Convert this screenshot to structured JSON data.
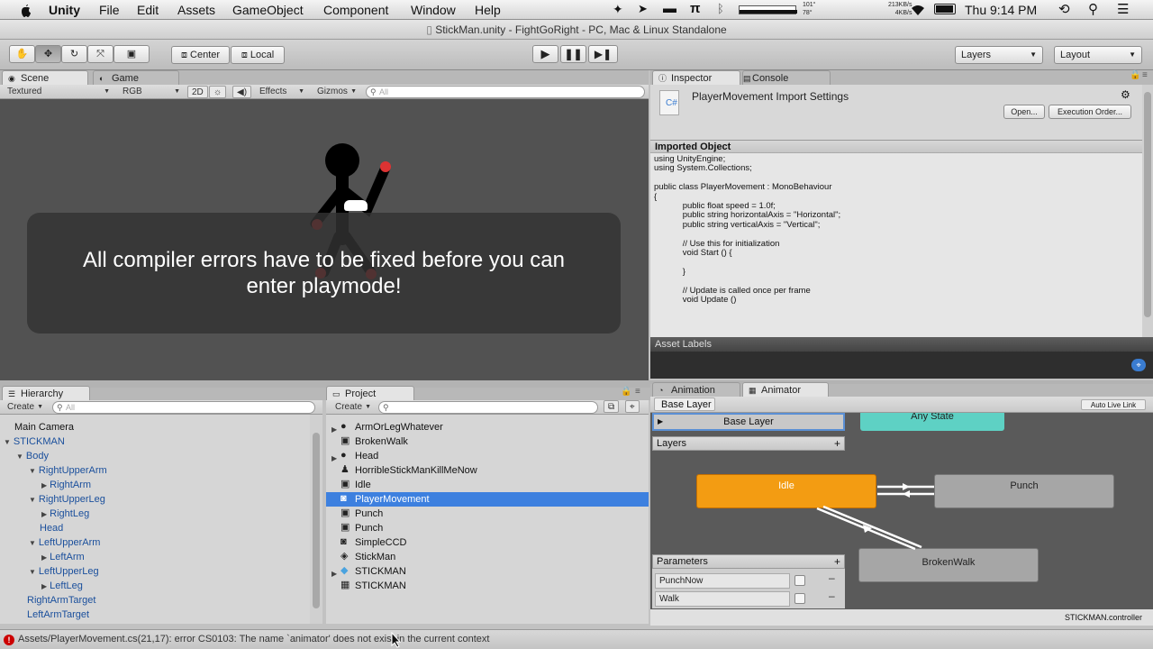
{
  "menubar": {
    "app": "Unity",
    "items": [
      "File",
      "Edit",
      "Assets",
      "GameObject",
      "Component",
      "Window",
      "Help"
    ],
    "temp_top": "101°",
    "temp_bottom": "78°",
    "net_top": "213KB/s",
    "net_bottom": "4KB/s",
    "clock": "Thu 9:14 PM"
  },
  "window": {
    "title": "StickMan.unity - FightGoRight - PC, Mac & Linux Standalone"
  },
  "toolbar": {
    "center_label": "Center",
    "local_label": "Local",
    "layers_label": "Layers",
    "layout_label": "Layout"
  },
  "scene": {
    "tab_scene": "Scene",
    "tab_game": "Game",
    "render_mode": "Textured",
    "color_mode": "RGB",
    "btn_2d": "2D",
    "effects": "Effects",
    "gizmos": "Gizmos",
    "search_placeholder": "All",
    "message": "All compiler errors have to be fixed before you can enter playmode!"
  },
  "inspector": {
    "tab_inspector": "Inspector",
    "tab_console": "Console",
    "title": "PlayerMovement Import Settings",
    "open_btn": "Open...",
    "exec_btn": "Execution Order...",
    "section": "Imported Object",
    "code": "using UnityEngine;\nusing System.Collections;\n\npublic class PlayerMovement : MonoBehaviour\n{\n\t\tpublic float speed = 1.0f;\n\t\tpublic string horizontalAxis = \"Horizontal\";\n\t\tpublic string verticalAxis = \"Vertical\";\n\n\t\t// Use this for initialization\n\t\tvoid Start () {\n\n\t\t}\n\n\t\t// Update is called once per frame\n\t\tvoid Update ()",
    "asset_labels": "Asset Labels"
  },
  "hierarchy": {
    "tab": "Hierarchy",
    "create": "Create",
    "search_placeholder": "All",
    "items": [
      {
        "label": "Main Camera",
        "indent": 0,
        "arrow": "",
        "black": true
      },
      {
        "label": "STICKMAN",
        "indent": 0,
        "arrow": "▼",
        "black": false
      },
      {
        "label": "Body",
        "indent": 1,
        "arrow": "▼",
        "black": false
      },
      {
        "label": "RightUpperArm",
        "indent": 2,
        "arrow": "▼",
        "black": false
      },
      {
        "label": "RightArm",
        "indent": 3,
        "arrow": "▶",
        "black": false
      },
      {
        "label": "RightUpperLeg",
        "indent": 2,
        "arrow": "▼",
        "black": false
      },
      {
        "label": "RightLeg",
        "indent": 3,
        "arrow": "▶",
        "black": false
      },
      {
        "label": "Head",
        "indent": 2,
        "arrow": "",
        "black": false
      },
      {
        "label": "LeftUpperArm",
        "indent": 2,
        "arrow": "▼",
        "black": false
      },
      {
        "label": "LeftArm",
        "indent": 3,
        "arrow": "▶",
        "black": false
      },
      {
        "label": "LeftUpperLeg",
        "indent": 2,
        "arrow": "▼",
        "black": false
      },
      {
        "label": "LeftLeg",
        "indent": 3,
        "arrow": "▶",
        "black": false
      },
      {
        "label": "RightArmTarget",
        "indent": 1,
        "arrow": "",
        "black": false
      },
      {
        "label": "LeftArmTarget",
        "indent": 1,
        "arrow": "",
        "black": false
      }
    ]
  },
  "project": {
    "tab": "Project",
    "create": "Create",
    "items": [
      {
        "label": "ArmOrLegWhatever",
        "icon": "sprite-icon",
        "arrow": "▶"
      },
      {
        "label": "BrokenWalk",
        "icon": "animation-icon",
        "arrow": ""
      },
      {
        "label": "Head",
        "icon": "sprite-icon",
        "arrow": "▶"
      },
      {
        "label": "HorribleStickManKillMeNow",
        "icon": "avatar-icon",
        "arrow": ""
      },
      {
        "label": "Idle",
        "icon": "animation-icon",
        "arrow": ""
      },
      {
        "label": "PlayerMovement",
        "icon": "script-icon",
        "arrow": ""
      },
      {
        "label": "Punch",
        "icon": "animation-icon",
        "arrow": ""
      },
      {
        "label": "Punch",
        "icon": "animation-icon",
        "arrow": ""
      },
      {
        "label": "SimpleCCD",
        "icon": "script-icon",
        "arrow": ""
      },
      {
        "label": "StickMan",
        "icon": "unity-scene-icon",
        "arrow": ""
      },
      {
        "label": "STICKMAN",
        "icon": "prefab-icon",
        "arrow": "▶"
      },
      {
        "label": "STICKMAN",
        "icon": "animator-controller-icon",
        "arrow": ""
      }
    ],
    "selected_index": 5
  },
  "animator": {
    "tab_animation": "Animation",
    "tab_animator": "Animator",
    "breadcrumb": "Base Layer",
    "auto_live_link": "Auto Live Link",
    "layer_name": "Base Layer",
    "layers_label": "Layers",
    "parameters_label": "Parameters",
    "params": [
      "PunchNow",
      "Walk"
    ],
    "states": {
      "any": "Any State",
      "idle": "Idle",
      "punch": "Punch",
      "broken": "BrokenWalk"
    },
    "controller": "STICKMAN.controller"
  },
  "status": {
    "error": "Assets/PlayerMovement.cs(21,17): error CS0103: The name `animator' does not exist in the current context"
  },
  "colors": {
    "selection": "#3d80df",
    "default_state": "#f39c12",
    "any_state": "#5ed1c4",
    "error": "#cc0000"
  }
}
